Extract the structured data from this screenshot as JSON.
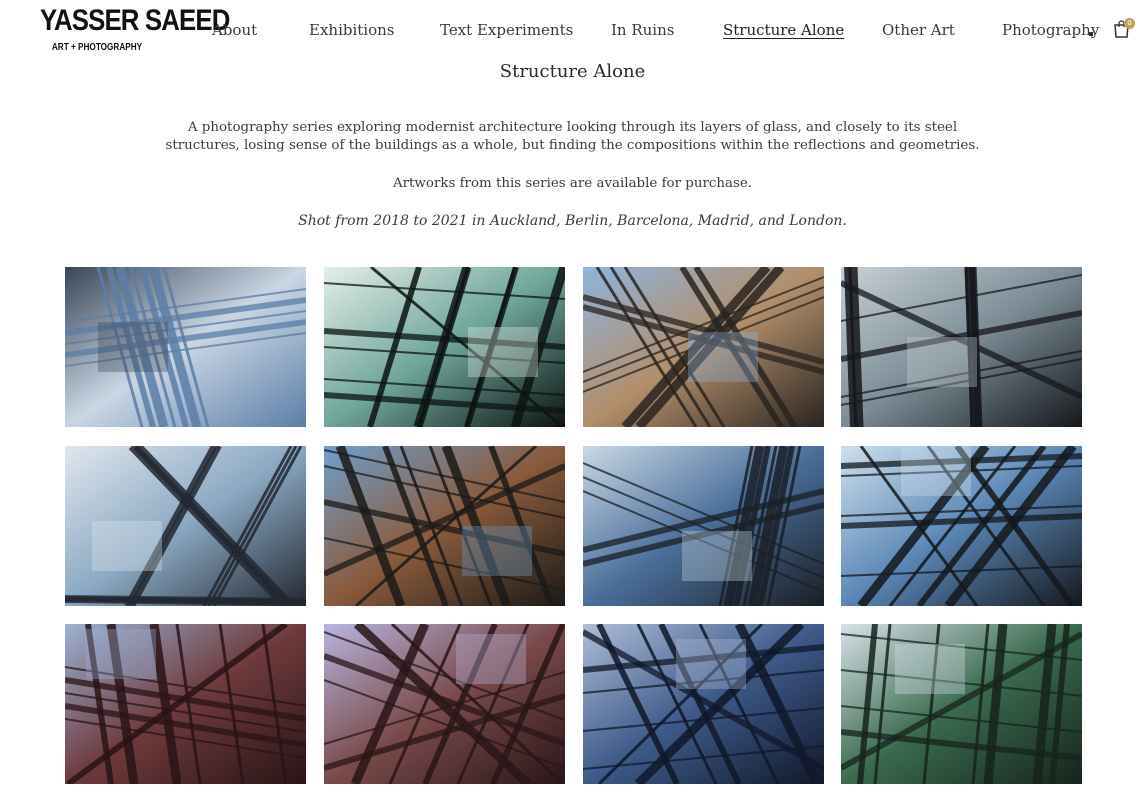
{
  "logo": {
    "name": "YASSER SAEED",
    "tagline": "ART + PHOTOGRAPHY"
  },
  "nav": {
    "items": [
      {
        "label": "About",
        "active": false
      },
      {
        "label": "Exhibitions",
        "active": false
      },
      {
        "label": "Text Experiments",
        "active": false
      },
      {
        "label": "In Ruins",
        "active": false
      },
      {
        "label": "Structure Alone",
        "active": true
      },
      {
        "label": "Other Art",
        "active": false
      },
      {
        "label": "Photography",
        "active": false
      }
    ],
    "cart_count": "0"
  },
  "page": {
    "title": "Structure Alone",
    "description": "A photography series exploring modernist architecture looking through its layers of glass, and closely to its steel structures, losing sense of the buildings as a whole, but finding the compositions within the reflections and geometries.",
    "availability": "Artworks from this series are available for purchase.",
    "shot_info": "Shot from 2018 to 2021 in Auckland, Berlin, Barcelona, Madrid, and London."
  },
  "gallery": {
    "photos": [
      {
        "name": "photo-1",
        "palette": [
          "#5b7ea8",
          "#c9d6e4",
          "#3a4656"
        ]
      },
      {
        "name": "photo-2",
        "palette": [
          "#0c1412",
          "#6fa59a",
          "#e4efe9"
        ]
      },
      {
        "name": "photo-3",
        "palette": [
          "#2a2420",
          "#b28e6a",
          "#8fb4de"
        ]
      },
      {
        "name": "photo-4",
        "palette": [
          "#15181c",
          "#7c8c96",
          "#c8d2d6"
        ]
      },
      {
        "name": "photo-5",
        "palette": [
          "#222831",
          "#8aa8c2",
          "#dfe7ee"
        ]
      },
      {
        "name": "photo-6",
        "palette": [
          "#1c1a18",
          "#8a5a3c",
          "#6fa0cc"
        ]
      },
      {
        "name": "photo-7",
        "palette": [
          "#1a1f26",
          "#4a6e9a",
          "#c9d9e6"
        ]
      },
      {
        "name": "photo-8",
        "palette": [
          "#14181d",
          "#5a86b5",
          "#cde0ee"
        ]
      },
      {
        "name": "photo-9",
        "palette": [
          "#2a1416",
          "#6e3a3c",
          "#9cb2d6"
        ]
      },
      {
        "name": "photo-10",
        "palette": [
          "#2a1618",
          "#7a4a4a",
          "#b8b6e0"
        ]
      },
      {
        "name": "photo-11",
        "palette": [
          "#10182a",
          "#3e5a8a",
          "#aebed8"
        ]
      },
      {
        "name": "photo-12",
        "palette": [
          "#16241c",
          "#3a6a4e",
          "#d8e2ea"
        ]
      }
    ]
  }
}
